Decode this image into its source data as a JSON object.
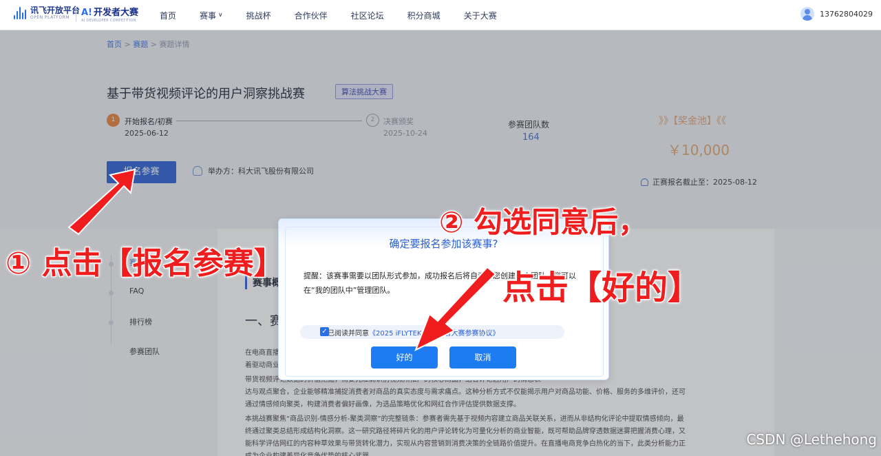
{
  "header": {
    "logo_title": "讯飞开放平台",
    "logo_sub": "OPEN PLATFORM",
    "logo2_title": "开发者大赛",
    "logo2_sub": "AI DEVELOPER COMPETITION",
    "nav": [
      {
        "label": "首页"
      },
      {
        "label": "赛事"
      },
      {
        "label": "挑战杯"
      },
      {
        "label": "合作伙伴"
      },
      {
        "label": "社区论坛"
      },
      {
        "label": "积分商城"
      },
      {
        "label": "关于大赛"
      }
    ],
    "phone": "13762804029"
  },
  "breadcrumb": {
    "home": "首页",
    "sep": ">",
    "events": "赛题",
    "current": "赛题详情"
  },
  "contest": {
    "title": "基于带货视频评论的用户洞察挑战赛",
    "tag": "算法挑战大赛",
    "step1_num": "1",
    "step1_label": "开始报名/初赛",
    "step1_date": "2025-06-12",
    "step2_num": "2",
    "step2_label": "决赛颁奖",
    "step2_date": "2025-10-24",
    "teams_label": "参赛团队数",
    "teams_value": "164",
    "prize_label": "》》【奖金池】《《",
    "prize_value": "￥10,000",
    "deadline": "正赛报名截止至：2025-08-12",
    "signup_label": "报名参赛",
    "organizer": "举办方：科大讯飞股份有限公司"
  },
  "sidebar": {
    "items": [
      {
        "label": "赛事概要"
      },
      {
        "label": "FAQ"
      },
      {
        "label": "排行榜"
      },
      {
        "label": "参赛团队"
      }
    ]
  },
  "content": {
    "heading": "赛事概要",
    "section_title": "一、赛事背景",
    "paragraphs": [
      "在电商直播与短视频带货快速发展的背景下，带货视频评论中不仅包含消费者对商品体验的直接反馈，更蕴含",
      "着驱动商业决策的关键信息，是连接消费需求与商业价值、评估网红带货效能的关键突破口。",
      "带货视频评论数据的价值挖掘，需要先准确识别视频所推广的核心商品，结合评论区用户的情感表",
      "达与观点聚合，企业能够精准捕捉消费者对商品的真实态度与需求痛点。这种分析方式不仅能揭示用户对商品功能、价格、服务的多维评价，还可",
      "通过情感倾向聚类，构建消费者偏好画像，为选品策略优化和网红合作评估提供数据支撑。",
      "本挑战赛聚焦“商品识别-情感分析-聚类洞察”的完整链条：参赛者需先基于视频内容建立商品关联关系，进而从非结构化评论中提取情感倾向，最",
      "终通过聚类总结形成结构化洞察。这一研究路径将碎片化的用户评论转化为可量化分析的商业智能，既可帮助品牌穿透数据迷雾把握消费心理，又",
      "能科学评估网红的内容种草效果与带货转化潜力，实现从内容营销到消费决策的全链路价值提升。在直播电商竞争白热化的当下，此类分析能力正",
      "成为企业构建差异化竞争优势的核心武器。"
    ]
  },
  "modal": {
    "title": "确定要报名参加该赛事?",
    "body": "提醒：该赛事需要以团队形式参加，成功报名后将自动为您创建一个团队，您可以在“我的团队中”管理团队。",
    "agree_prefix": "我已阅读并同意",
    "agree_link": "《2025 iFLYTEK AI开发者大赛参赛协议》",
    "ok_label": "好的",
    "cancel_label": "取消"
  },
  "annotations": {
    "step1": "① 点击【报名参赛】",
    "step2": "② 勾选同意后，",
    "step3": "点击【好的】"
  },
  "watermark": "CSDN @Lethehong",
  "colors": {
    "accent": "#2a5fd6",
    "annotation": "#ef1d1d",
    "prize": "#e0a46e",
    "step_active": "#e9823a"
  }
}
